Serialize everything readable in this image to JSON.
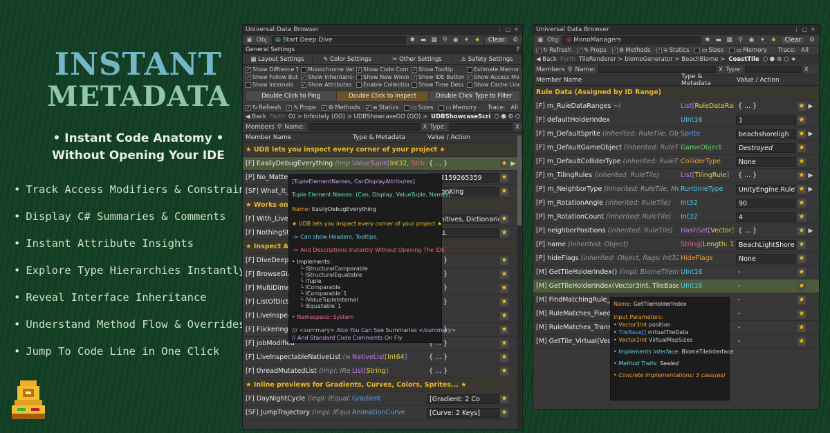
{
  "promo": {
    "title1": "INSTANT",
    "title2": "METADATA",
    "sub1": "• Instant Code Anatomy •",
    "sub2": "Without Opening Your IDE",
    "features": [
      "Track Access Modifiers & Constraints",
      "Display C# Summaries & Comments",
      "Instant Attribute Insights",
      "Explore Type Hierarchies Instantly",
      "Reveal Interface Inheritance",
      "Understand Method Flow & Overrides",
      "Jump To Code Line in One Click"
    ]
  },
  "left": {
    "title": "Universal Data Browser",
    "obj_label": "Obj:",
    "obj_value": "Start Deep Dive",
    "clear": "Clear",
    "general_settings": "General Settings",
    "tabs": [
      "Layout Settings",
      "Color Settings",
      "Other Settings",
      "Safety Settings"
    ],
    "checks": [
      [
        "Show Diffrence Tr",
        true
      ],
      [
        "Monochrome Valu",
        false
      ],
      [
        "Show Code Comments",
        true
      ],
      [
        "Show Tooltip",
        true
      ],
      [
        "Estimate Memory U",
        false
      ],
      [
        "Show Follow Butto",
        true
      ],
      [
        "Show Inheritance",
        true
      ],
      [
        "Show New Window Butto",
        false
      ],
      [
        "Show IDE Button",
        true
      ],
      [
        "Show Access Modif",
        true
      ],
      [
        "Show Internals",
        false
      ],
      [
        "Show Attributes",
        true
      ],
      [
        "Enable Collection Insight",
        false
      ],
      [
        "Show Time Debu",
        false
      ],
      [
        "Show Cache Lines",
        false
      ]
    ],
    "dbl": [
      "Double Click to Ping",
      "Double Click to Inspect",
      "Double Click Type to Filter"
    ],
    "filters": [
      "Refresh",
      "Props",
      "Methods",
      "Statics",
      "Sizes",
      "Memory"
    ],
    "trace": "Trace:",
    "trace_val": "All",
    "nav": {
      "back": "Back",
      "fwd": "Forth",
      "path": "O)  >  Infinitely (GO)  >  UDBShowcaseGO (GO)  >",
      "cur": "UDBShowcaseScri"
    },
    "members": "Members",
    "name_label": "Name:",
    "type_label": "Type:",
    "cols": [
      "Member Name",
      "Type & Metadata",
      "Value / Action"
    ],
    "rows": [
      {
        "k": "sec",
        "name": "★ UDB lets you inspect every corner of your project ★"
      },
      {
        "k": "hl",
        "kind": "[F]",
        "name": "EasilyDebugEverything",
        "inh": " (impl: IStru",
        "type": "ValueTuple",
        "type2": "Int32",
        "type3": "String",
        "val": "{ ... }",
        "star": true,
        "arr": true
      },
      {
        "k": "n",
        "kind": "[P]",
        "name": "No_Matter",
        "inh": "",
        "type": "",
        "val": "3.14159265359",
        "star": true
      },
      {
        "k": "n",
        "kind": "[SF]",
        "name": "What_It_IS",
        "inh": "",
        "type": "",
        "val": "VisionKing",
        "star": true
      },
      {
        "k": "sec",
        "name": "★ Works on Al"
      },
      {
        "k": "n",
        "kind": "[F]",
        "name": "With_LiveCh",
        "inh": "",
        "type": "",
        "val": "Primitives, Dictionaries, C",
        "star": true
      },
      {
        "k": "n",
        "kind": "[F]",
        "name": "NothingStays",
        "inh": "",
        "type": "",
        "val": "NULL",
        "star": true
      },
      {
        "k": "sec",
        "name": "★ Inspect Almo"
      },
      {
        "k": "n",
        "kind": "[F]",
        "name": "DiveDeepNe",
        "inh": "",
        "type": "",
        "val": "{ ... }",
        "star": true
      },
      {
        "k": "n",
        "kind": "[F]",
        "name": "BrowseGIAN",
        "inh": "",
        "type": "",
        "val": "{ ... }",
        "star": true
      },
      {
        "k": "n",
        "kind": "[F]",
        "name": "MultiDimens",
        "inh": "",
        "type": "",
        "val": "{ ... }",
        "star": true
      },
      {
        "k": "n",
        "kind": "[F]",
        "name": "ListOfDictOf",
        "inh": "",
        "type": "",
        "val": "{ ... }",
        "star": true
      },
      {
        "k": "n",
        "kind": "[F]",
        "name": "LiveInspectU",
        "inh": "",
        "type": "",
        "val": "",
        "star": true
      },
      {
        "k": "n",
        "kind": "[F]",
        "name": "FlickeringUn",
        "inh": "",
        "type": "",
        "val": "{ ... }",
        "star": true
      },
      {
        "k": "n",
        "kind": "[F]",
        "name": "jobModified",
        "inh": "",
        "type": "",
        "val": "{ ... }",
        "star": true
      },
      {
        "k": "n",
        "kind": "[F]",
        "name": "LiveInspectableNativeList",
        "inh": " (where",
        "type": "NativeList",
        "type2": "Int64",
        "val": "{ ... }",
        "star": true
      },
      {
        "k": "n",
        "kind": "[F]",
        "name": "threadMutatedList",
        "inh": " (impl: IReadOnl",
        "type": "List",
        "type2": "String",
        "val": "{ ... }",
        "star": true
      },
      {
        "k": "sec",
        "name": "★ Inline previews for Gradients, Curves, Colors, Sprites... ★"
      },
      {
        "k": "n",
        "kind": "[F]",
        "name": "DayNightCycle",
        "inh": " (impl: IEquatable`1",
        "type": "Gradient",
        "val": "[Gradient: 2 Co",
        "star": true
      },
      {
        "k": "n",
        "kind": "[SF]",
        "name": "JumpTrajectory",
        "inh": " (impl: IEquatab",
        "type": "AnimationCurve",
        "val": "[Curve: 2 Keys]",
        "star": true
      }
    ],
    "tooltip": {
      "l1": "[TupleElementNames, CanDisplayAttributes]",
      "l2": "Tuple Element Names: (Can, Display, ValueTuple, Names)",
      "name_label": "Name:",
      "name_val": "EasilyDebugEverything",
      "l3": "★ UDB lets you inspect every corner of your project ★",
      "l4": "-> Can show Headers, Tooltips,",
      "l5": "-> And Descriptions Instantly Without Opening The IDE",
      "impl": "• Implements:",
      "ifaces": [
        "IStructuralComparable",
        "IStructuralEquatable",
        "ITuple",
        "IComparable",
        "IComparable`1",
        "IValueTupleInternal",
        "IEquatable`1"
      ],
      "ns": "• Namespace: System",
      "c1": "/// <summary>  Also You Can See Summaries  </summary>",
      "c2": "// And Standard Code Comments On Fly"
    }
  },
  "right": {
    "title": "Universal Data Browser",
    "obj_label": "Obj:",
    "obj_value": "MonoManagers",
    "clear": "Clear",
    "filters": [
      "Refresh",
      "Props",
      "Methods",
      "Statics",
      "Sizes",
      "Memory"
    ],
    "trace": "Trace:",
    "trace_val": "All",
    "nav": {
      "back": "Back",
      "fwd": "Forth",
      "path": "TileRenderer  >  biomeGenerator  >  BeachBiome  >",
      "cur": "CoastTile"
    },
    "members": "Members",
    "name_label": "Name:",
    "type_label": "Type:",
    "cols": [
      "Member Name",
      "Type & Metadata",
      "Value / Action"
    ],
    "rows": [
      {
        "k": "sec",
        "name": "Rule Data (Assigned by ID Range)"
      },
      {
        "k": "n",
        "kind": "[F]",
        "name": "m_RuleDataRanges",
        "inh": " ~i",
        "type": "List",
        "type2": "RuleDataRang",
        "val": "{ ... }",
        "star": true,
        "arr": true
      },
      {
        "k": "n",
        "kind": "[F]",
        "name": "defaultHolderIndex",
        "inh": "",
        "type": "UInt16",
        "val": "1",
        "star": true
      },
      {
        "k": "n",
        "kind": "[F]",
        "name": "m_DefaultSprite",
        "inh": " (inherited: RuleTile, Object)",
        "type": "Sprite",
        "val": "beachshoreligh",
        "star": true,
        "arr": true
      },
      {
        "k": "n",
        "kind": "[F]",
        "name": "m_DefaultGameObject",
        "inh": " (inherited: RuleTile, Ob",
        "type": "GameObject",
        "val": "Destroyed",
        "star": true
      },
      {
        "k": "n",
        "kind": "[F]",
        "name": "m_DefaultColliderType",
        "inh": " (inherited: RuleTile, en",
        "type": "ColliderType",
        "val": "None",
        "star": true
      },
      {
        "k": "n",
        "kind": "[F]",
        "name": "m_TilingRules",
        "inh": " (inherited: RuleTile)",
        "type": "List",
        "type2": "TilingRule",
        "val": "{ ... }",
        "star": true,
        "arr": true
      },
      {
        "k": "n",
        "kind": "[P]",
        "name": "m_NeighborType",
        "inh": " (inherited: RuleTile, Membe",
        "type": "RuntimeType",
        "val": "UnityEngine.RuleTi",
        "star": true,
        "arr": true
      },
      {
        "k": "n",
        "kind": "[P]",
        "name": "m_RotationAngle",
        "inh": " (inherited: RuleTile)",
        "type": "Int32",
        "val": "90",
        "star": true
      },
      {
        "k": "n",
        "kind": "[P]",
        "name": "m_RotationCount",
        "inh": " (inherited: RuleTile)",
        "type": "Int32",
        "val": "4",
        "star": true
      },
      {
        "k": "n",
        "kind": "[P]",
        "name": "neighborPositions",
        "inh": " (inherited: RuleTile)",
        "type": "HashSet",
        "type2": "Vector3I",
        "val": "{ ... }",
        "star": true,
        "arr": true
      },
      {
        "k": "n",
        "kind": "[P]",
        "name": "name",
        "inh": " (inherited: Object)",
        "type": "String",
        "type2": "Length: 15",
        "val": "BeachLightShore",
        "star": true
      },
      {
        "k": "n",
        "kind": "[P]",
        "name": "hideFlags",
        "inh": " (inherited: Object, flags: Int32)",
        "type": "HideFlags",
        "val": "None",
        "star": true
      },
      {
        "k": "n",
        "kind": "[M]",
        "name": "GetTileHolderIndex()",
        "inh": " (impl: BiomeTileInterfa",
        "type": "UInt16",
        "val": "-",
        "star": true
      },
      {
        "k": "hl",
        "kind": "[M]",
        "name": "GetTileHolderIndex(Vector3Int, TileBase[], V",
        "inh": "",
        "type": "UInt16",
        "val": "-",
        "star": true
      },
      {
        "k": "n",
        "kind": "[M]",
        "name": "FindMatchingRule_Vi",
        "inh": "",
        "type": "",
        "val": "-",
        "star": true
      },
      {
        "k": "n",
        "kind": "[M]",
        "name": "RuleMatches_Fixed(T",
        "inh": "",
        "type": "",
        "val": "-",
        "star": true
      },
      {
        "k": "n",
        "kind": "[M]",
        "name": "RuleMatches_Transfo",
        "inh": "",
        "type": "",
        "val": "-",
        "star": true
      },
      {
        "k": "n",
        "kind": "[M]",
        "name": "GetTile_Virtual(Vecto",
        "inh": "",
        "type": "",
        "val": "-",
        "star": true
      }
    ],
    "tooltip": {
      "name_label": "Name:",
      "name_val": "GetTileHolderIndex",
      "params": "Input Parameters:",
      "p": [
        [
          "Vector3Int",
          "position"
        ],
        [
          "TileBase[]",
          "virtualTileData"
        ],
        [
          "Vector2Int",
          "VirtualMapSizes"
        ]
      ],
      "impl": "• Implements Interface:",
      "impl_val": "BiomeTileInterface",
      "traits": "• Method Traits:",
      "traits_val": "Sealed",
      "concrete": "• Concrete Implementations:",
      "concrete_val": "3 class(es)"
    }
  }
}
